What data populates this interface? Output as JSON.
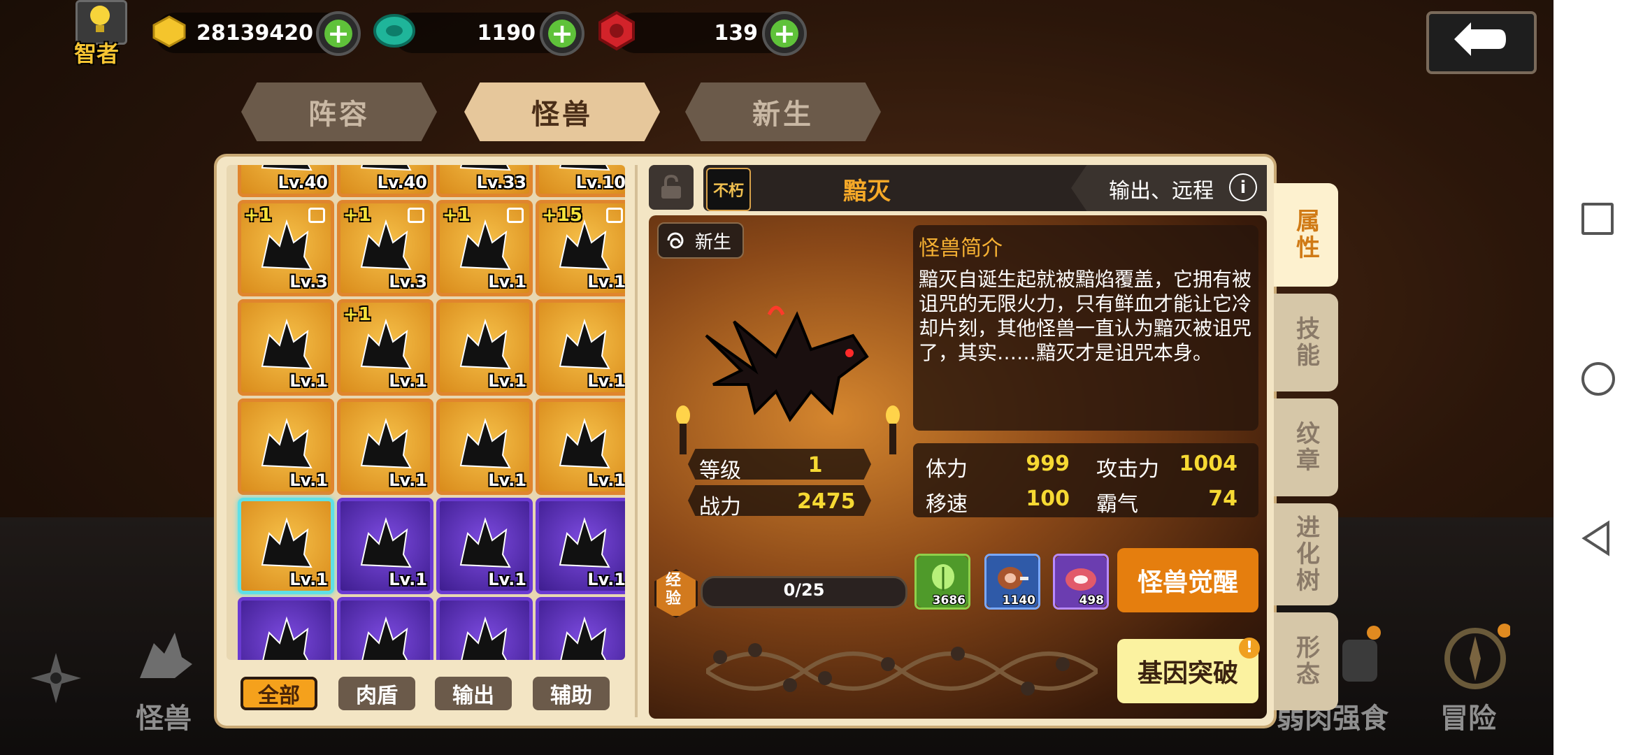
{
  "player": {
    "title": "智者"
  },
  "currencies": [
    {
      "icon": "gold-icon",
      "value": "28139420"
    },
    {
      "icon": "gem-green-icon",
      "value": "1190"
    },
    {
      "icon": "gem-red-icon",
      "value": "139"
    }
  ],
  "top_tabs": [
    {
      "label": "阵容",
      "active": false
    },
    {
      "label": "怪兽",
      "active": true
    },
    {
      "label": "新生",
      "active": false
    }
  ],
  "monster_grid": {
    "rows": [
      [
        {
          "lv": "Lv.40"
        },
        {
          "lv": "Lv.40"
        },
        {
          "lv": "Lv.33"
        },
        {
          "lv": "Lv.10"
        }
      ],
      [
        {
          "lv": "Lv.3",
          "plus": "+1",
          "lock": true
        },
        {
          "lv": "Lv.3",
          "plus": "+1",
          "lock": true
        },
        {
          "lv": "Lv.1",
          "plus": "+1",
          "lock": true
        },
        {
          "lv": "Lv.1",
          "plus": "+15",
          "lock": true
        }
      ],
      [
        {
          "lv": "Lv.1"
        },
        {
          "lv": "Lv.1",
          "plus": "+1"
        },
        {
          "lv": "Lv.1"
        },
        {
          "lv": "Lv.1"
        }
      ],
      [
        {
          "lv": "Lv.1"
        },
        {
          "lv": "Lv.1"
        },
        {
          "lv": "Lv.1"
        },
        {
          "lv": "Lv.1"
        }
      ],
      [
        {
          "lv": "Lv.1",
          "selected": true
        },
        {
          "lv": "Lv.1",
          "color": "purple"
        },
        {
          "lv": "Lv.1",
          "color": "purple"
        },
        {
          "lv": "Lv.1",
          "color": "purple"
        }
      ],
      [
        {
          "lv": "",
          "color": "purple"
        },
        {
          "lv": "",
          "color": "purple"
        },
        {
          "lv": "",
          "color": "purple"
        },
        {
          "lv": "",
          "color": "purple"
        }
      ]
    ]
  },
  "filters": [
    {
      "label": "全部",
      "active": true
    },
    {
      "label": "肉盾",
      "active": false
    },
    {
      "label": "输出",
      "active": false
    },
    {
      "label": "辅助",
      "active": false
    }
  ],
  "monster": {
    "badge": "不朽",
    "name": "黯灭",
    "role": "输出、远程",
    "tag": "新生",
    "intro_title": "怪兽简介",
    "intro_text": "黯灭自诞生起就被黯焰覆盖，它拥有被诅咒的无限火力，只有鲜血才能让它冷却片刻，其他怪兽一直认为黯灭被诅咒了，其实……黯灭才是诅咒本身。",
    "level_label": "等级",
    "level": "1",
    "power_label": "战力",
    "power": "2475",
    "stats": [
      {
        "label": "体力",
        "value": "999"
      },
      {
        "label": "攻击力",
        "value": "1004"
      },
      {
        "label": "移速",
        "value": "100"
      },
      {
        "label": "霸气",
        "value": "74"
      }
    ],
    "exp_label": "经验",
    "exp": "0/25",
    "progress": 0,
    "items": [
      {
        "icon": "vegetable-icon",
        "count": "3686",
        "color": "#4f9a2a"
      },
      {
        "icon": "ham-icon",
        "count": "1140",
        "color": "#2f5aa8"
      },
      {
        "icon": "meat-icon",
        "count": "498",
        "color": "#6b3db0"
      }
    ],
    "awaken_label": "怪兽觉醒",
    "gene_label": "基因突破"
  },
  "side_tabs": [
    {
      "label": "属性",
      "active": true
    },
    {
      "label": "技能",
      "active": false
    },
    {
      "label": "纹章",
      "active": false
    },
    {
      "label": "进化树",
      "active": false
    },
    {
      "label": "形态",
      "active": false
    }
  ],
  "bottom_nav": {
    "monster": "怪兽",
    "feast": "弱肉强食",
    "adventure": "冒险"
  },
  "colors": {
    "accent": "#f5a11c",
    "stat_yellow": "#f6d933",
    "panel": "#f3e5c4"
  }
}
